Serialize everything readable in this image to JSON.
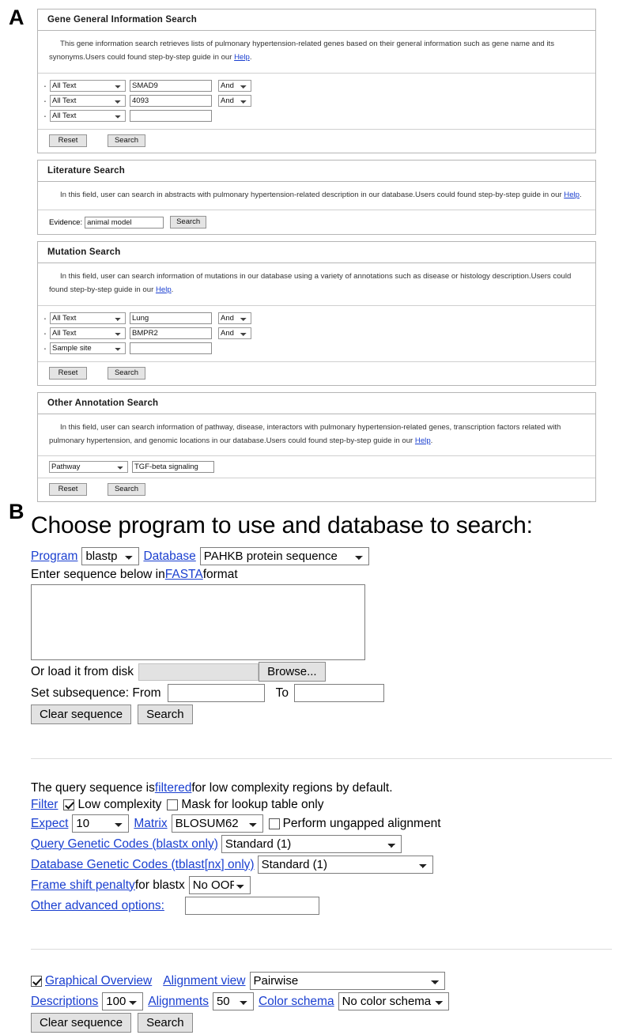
{
  "panels": {
    "a_letter": "A",
    "b_letter": "B"
  },
  "panel_a": {
    "gene_search": {
      "title": "Gene General Information Search",
      "description_before_link": "This gene information search retrieves lists of pulmonary hypertension-related genes based on their general information such as gene name and its synonyms.Users could found step-by-step guide in our ",
      "help_link": "Help",
      "description_after_link": ".",
      "rows": [
        {
          "field": "All Text",
          "value": "SMAD9",
          "operator": "And",
          "has_operator": true
        },
        {
          "field": "All Text",
          "value": "4093",
          "operator": "And",
          "has_operator": true
        },
        {
          "field": "All Text",
          "value": "",
          "operator": "",
          "has_operator": false
        }
      ],
      "reset_label": "Reset",
      "search_label": "Search"
    },
    "literature_search": {
      "title": "Literature Search",
      "description_before_link": "In this field, user can search in abstracts with pulmonary hypertension-related description in our database.Users could found step-by-step guide in our ",
      "help_link": "Help",
      "description_after_link": ".",
      "evidence_label": "Evidence:",
      "evidence_value": "animal model",
      "search_label": "Search"
    },
    "mutation_search": {
      "title": "Mutation Search",
      "description_before_link": "In this field, user can search information of mutations in our database using a variety of annotations such as disease or histology description.Users could found step-by-step guide in our ",
      "help_link": "Help",
      "description_after_link": ".",
      "rows": [
        {
          "field": "All Text",
          "value": "Lung",
          "operator": "And",
          "has_operator": true
        },
        {
          "field": "All Text",
          "value": "BMPR2",
          "operator": "And",
          "has_operator": true
        },
        {
          "field": "Sample site",
          "value": "",
          "operator": "",
          "has_operator": false
        }
      ],
      "reset_label": "Reset",
      "search_label": "Search"
    },
    "other_annotation_search": {
      "title": "Other Annotation Search",
      "description_before_link": "In this field, user can search information of pathway, disease, interactors with pulmonary hypertension-related genes, transcription factors related with pulmonary hypertension, and genomic locations in our database.Users could found step-by-step guide in our ",
      "help_link": "Help",
      "description_after_link": ".",
      "field": "Pathway",
      "value": "TGF-beta signaling",
      "reset_label": "Reset",
      "search_label": "Search"
    }
  },
  "panel_b": {
    "title": "Choose program to use and database to search:",
    "program_label": "Program",
    "program_value": "blastp",
    "database_label": "Database",
    "database_value": "PAHKB protein sequence",
    "enter_seq_prefix": "Enter sequence below in ",
    "fasta_link": "FASTA",
    "enter_seq_suffix": " format",
    "sequence_value": "",
    "load_disk_label": "Or load it from disk",
    "browse_label": "Browse...",
    "subsequence_label": "Set subsequence: From",
    "subsequence_from": "",
    "to_label": "To",
    "subsequence_to": "",
    "clear_sequence_label": "Clear sequence",
    "search_label": "Search",
    "filtered_note_prefix": "The query sequence is ",
    "filtered_link": "filtered",
    "filtered_note_suffix": " for low complexity regions by default.",
    "filter_label": "Filter",
    "low_complexity_label": "Low complexity",
    "low_complexity_checked": true,
    "mask_lookup_label": "Mask for lookup table only",
    "mask_lookup_checked": false,
    "expect_label": "Expect",
    "expect_value": "10",
    "matrix_label": "Matrix",
    "matrix_value": "BLOSUM62",
    "ungapped_label": "Perform ungapped alignment",
    "ungapped_checked": false,
    "query_genetic_codes_label": "Query Genetic Codes (blastx only)",
    "query_genetic_codes_value": "Standard (1)",
    "db_genetic_codes_label": "Database Genetic Codes (tblast[nx] only)",
    "db_genetic_codes_value": "Standard (1)",
    "frame_shift_label": "Frame shift penalty",
    "frame_shift_suffix": " for blastx",
    "frame_shift_value": "No OOF",
    "other_advanced_label": "Other advanced options:",
    "other_advanced_value": "",
    "graphical_overview_label": "Graphical Overview",
    "graphical_overview_checked": true,
    "alignment_view_label": "Alignment view",
    "alignment_view_value": "Pairwise",
    "descriptions_label": "Descriptions",
    "descriptions_value": "100",
    "alignments_label": "Alignments",
    "alignments_value": "50",
    "color_schema_label": "Color schema",
    "color_schema_value": "No color schema",
    "clear_sequence_label_2": "Clear sequence",
    "search_label_2": "Search"
  },
  "colors": {
    "link": "#1a3fd0",
    "border": "#b5b5b5",
    "button_face": "#e2e2e2"
  }
}
